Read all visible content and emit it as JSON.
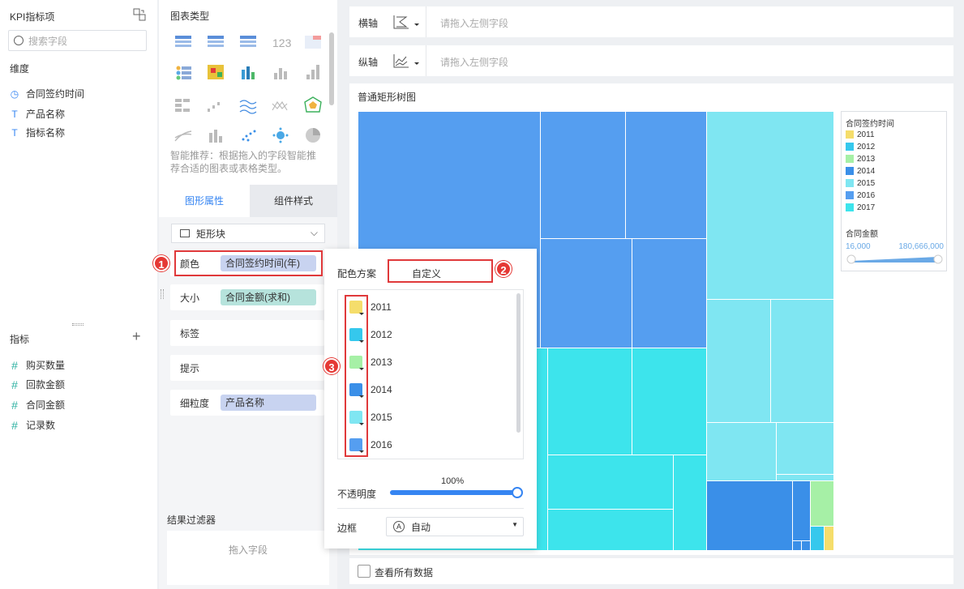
{
  "left": {
    "title": "KPI指标项",
    "search_placeholder": "搜索字段",
    "dim_header": "维度",
    "dims": [
      "合同签约时间",
      "产品名称",
      "指标名称"
    ],
    "metric_header": "指标",
    "metrics": [
      "购买数量",
      "回款金额",
      "合同金额",
      "记录数"
    ]
  },
  "mid": {
    "chart_type_title": "图表类型",
    "tip": "智能推荐：根据拖入的字段智能推荐合适的图表或表格类型。",
    "tab_shape": "图形属性",
    "tab_style": "组件样式",
    "shape_select": "矩形块",
    "color_label": "颜色",
    "color_field": "合同签约时间(年)",
    "size_label": "大小",
    "size_field": "合同金额(求和)",
    "label_label": "标签",
    "tooltip_label": "提示",
    "granularity_label": "细粒度",
    "granularity_field": "产品名称",
    "filter_title": "结果过滤器",
    "filter_drop": "拖入字段"
  },
  "axes": {
    "x_label": "横轴",
    "x_placeholder": "请拖入左侧字段",
    "y_label": "纵轴",
    "y_placeholder": "请拖入左侧字段"
  },
  "chart": {
    "title": "普通矩形树图",
    "view_all": "查看所有数据",
    "legend_title": "合同签约时间",
    "legend_items": [
      {
        "label": "2011",
        "color": "#f5dd6b"
      },
      {
        "label": "2012",
        "color": "#35c8ed"
      },
      {
        "label": "2013",
        "color": "#a6f0a6"
      },
      {
        "label": "2014",
        "color": "#3a8fe8"
      },
      {
        "label": "2015",
        "color": "#7fe6f2"
      },
      {
        "label": "2016",
        "color": "#559ef0"
      },
      {
        "label": "2017",
        "color": "#3de4ec"
      }
    ],
    "size_title": "合同金额",
    "size_min": "16,000",
    "size_max": "180,666,000"
  },
  "popup": {
    "scheme_label": "配色方案",
    "scheme_value": "自定义",
    "colors": [
      {
        "year": "2011",
        "color": "#f5dd6b"
      },
      {
        "year": "2012",
        "color": "#35c8ed"
      },
      {
        "year": "2013",
        "color": "#a6f0a6"
      },
      {
        "year": "2014",
        "color": "#3a8fe8"
      },
      {
        "year": "2015",
        "color": "#7fe6f2"
      },
      {
        "year": "2016",
        "color": "#559ef0"
      }
    ],
    "opacity_label": "不透明度",
    "opacity_value": "100%",
    "opacity": 1.0,
    "border_label": "边框",
    "border_value": "自动"
  },
  "badges": [
    "1",
    "2",
    "3"
  ]
}
